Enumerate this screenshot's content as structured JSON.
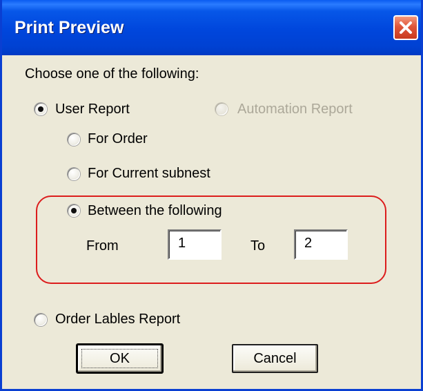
{
  "window": {
    "title": "Print Preview"
  },
  "instruction": "Choose one of the following:",
  "options": {
    "user_report": {
      "label": "User Report",
      "checked": true
    },
    "automation_report": {
      "label": "Automation Report",
      "enabled": false
    },
    "for_order": {
      "label": "For Order",
      "checked": false
    },
    "for_current_subnest": {
      "label": "For Current subnest",
      "checked": false
    },
    "between": {
      "label": "Between the following",
      "checked": true
    },
    "order_lables_report": {
      "label": "Order Lables Report",
      "checked": false
    }
  },
  "range": {
    "from_label": "From",
    "from_value": "1",
    "to_label": "To",
    "to_value": "2"
  },
  "buttons": {
    "ok": "OK",
    "cancel": "Cancel"
  },
  "colors": {
    "titlebar": "#0046dc",
    "highlight_border": "#dc1c1c",
    "dialog_bg": "#ece9d8"
  }
}
